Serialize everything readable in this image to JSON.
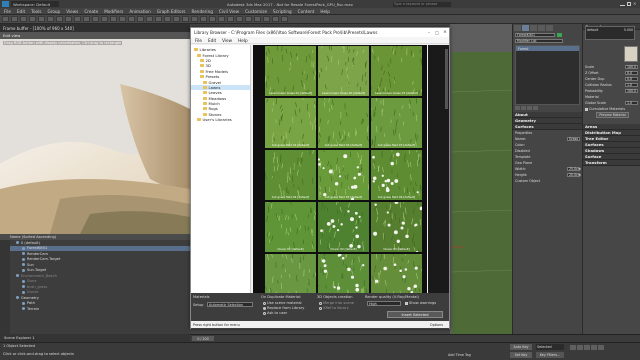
{
  "app": {
    "window_title": "Autodesk 3ds Max 2017 - Not for Resale   ForestPack_GPU_Rsc.max",
    "workspace": "Workspace: Default",
    "search_placeholder": "Type a keyword or phrase"
  },
  "menus": [
    "File",
    "Edit",
    "Tools",
    "Group",
    "Views",
    "Create",
    "Modifiers",
    "Animation",
    "Graph Editors",
    "Rendering",
    "Civil View",
    "Customize",
    "Scripting",
    "Content",
    "Help"
  ],
  "viewport": {
    "title": "Frame buffer - [100% of 960 x 540]",
    "subtitle": "Edit view",
    "hint": "Drag RGB button with display cancellation, Ctrl-drag to rectangle"
  },
  "scene_explorer": {
    "header": "Name (Sorted Ascending)",
    "rows": [
      {
        "label": "0 (default)",
        "sel": false,
        "dim": false,
        "indent": 2
      },
      {
        "label": "ForestKit01",
        "sel": true,
        "dim": false,
        "indent": 4
      },
      {
        "label": "RenderCam",
        "sel": false,
        "dim": false,
        "indent": 4
      },
      {
        "label": "RenderCam.Target",
        "sel": false,
        "dim": false,
        "indent": 4
      },
      {
        "label": "Sun",
        "sel": false,
        "dim": false,
        "indent": 4
      },
      {
        "label": "Sun.Target",
        "sel": false,
        "dim": false,
        "indent": 4
      },
      {
        "label": "Environment_Beach",
        "sel": false,
        "dim": true,
        "indent": 2
      },
      {
        "label": "Dune",
        "sel": false,
        "dim": true,
        "indent": 4
      },
      {
        "label": "bush_grass",
        "sel": false,
        "dim": true,
        "indent": 4
      },
      {
        "label": "Dunes",
        "sel": false,
        "dim": true,
        "indent": 4
      },
      {
        "label": "Geometry",
        "sel": false,
        "dim": false,
        "indent": 2
      },
      {
        "label": "Path",
        "sel": false,
        "dim": false,
        "indent": 4
      },
      {
        "label": "Terrain",
        "sel": false,
        "dim": false,
        "indent": 4
      }
    ],
    "footer": "Scene Explorer 1"
  },
  "library_browser": {
    "title": "Library Browser - C:\\Program Files (x86)\\Itoo Software\\Forest Pack Pro\\lib\\Presets\\Lawns",
    "menu": [
      "File",
      "Edit",
      "View",
      "Help"
    ],
    "tree": [
      {
        "label": "Libraries",
        "indent": 1,
        "sel": false
      },
      {
        "label": "Forest Library",
        "indent": 2,
        "sel": false
      },
      {
        "label": "2D",
        "indent": 3,
        "sel": false
      },
      {
        "label": "3D",
        "indent": 3,
        "sel": false
      },
      {
        "label": "Free Models",
        "indent": 3,
        "sel": false
      },
      {
        "label": "Presets",
        "indent": 3,
        "sel": false
      },
      {
        "label": "Gravel",
        "indent": 4,
        "sel": false
      },
      {
        "label": "Lawns",
        "indent": 4,
        "sel": true
      },
      {
        "label": "Leaves",
        "indent": 4,
        "sel": false
      },
      {
        "label": "Meadows",
        "indent": 4,
        "sel": false
      },
      {
        "label": "Mulch",
        "indent": 4,
        "sel": false
      },
      {
        "label": "Rugs",
        "indent": 4,
        "sel": false
      },
      {
        "label": "Stones",
        "indent": 4,
        "sel": false
      },
      {
        "label": "User's Libraries",
        "indent": 2,
        "sel": false
      }
    ],
    "thumbs": [
      {
        "caption": "Lawnmower Grass 01 [default]",
        "tone": "#6f9a3a",
        "flowers": false
      },
      {
        "caption": "Lawnmower Grass 02 [default]",
        "tone": "#7da448",
        "flowers": false
      },
      {
        "caption": "Lawnmower Grass 03 [default]",
        "tone": "#6a9536",
        "flowers": false
      },
      {
        "caption": "Cut grass field 01 [default]",
        "tone": "#78a443",
        "flowers": false
      },
      {
        "caption": "Cut grass field 02 [default]",
        "tone": "#6e9d3d",
        "flowers": false
      },
      {
        "caption": "Cut grass field 03 [default]",
        "tone": "#6b9a3f",
        "flowers": false
      },
      {
        "caption": "Cut grass field 04 [default]",
        "tone": "#5f8f34",
        "flowers": false
      },
      {
        "caption": "Cut grass field 05 [default]",
        "tone": "#6a9b3a",
        "flowers": true
      },
      {
        "caption": "Cut grass field 06 [default]",
        "tone": "#5d8c33",
        "flowers": true
      },
      {
        "caption": "Clover 01 [default]",
        "tone": "#5f9536",
        "flowers": false
      },
      {
        "caption": "Clover 02 [default]",
        "tone": "#4f8230",
        "flowers": true
      },
      {
        "caption": "Clover 03 [default]",
        "tone": "#557f2f",
        "flowers": true
      },
      {
        "caption": "",
        "tone": "#6a9842",
        "flowers": false
      },
      {
        "caption": "",
        "tone": "#5c8f38",
        "flowers": true
      },
      {
        "caption": "",
        "tone": "#648e3a",
        "flowers": true
      }
    ],
    "bottom": {
      "materials_label": "Materials",
      "dup_label": "On Duplicate Material:",
      "setup_label": "Setup",
      "setup_value": "Automatic Selection",
      "use_scene": "Use scene material",
      "replace_lib": "Replace from Library",
      "ask_user": "Ask to user",
      "objects_label": "3D Objects creation",
      "merge_scene": "Merge into scene",
      "xref_library": "XRef to library",
      "render_quality_label": "Render quality (V-Ray/Mental)",
      "quality_value": "High",
      "show_warnings": "Show warnings",
      "insert_button": "Insert Selected",
      "help_text": "Press right button for menu",
      "options_label": "Options"
    }
  },
  "command_panel": {
    "object_name": "ForestKit01",
    "modifier_list": "Modifier List",
    "modifier_item": "Forest",
    "rollouts_left": [
      "About",
      "Geometry",
      "Surfaces"
    ],
    "params": [
      {
        "label": "Properties",
        "value": ""
      },
      {
        "label": "Name:",
        "value": "Grass"
      },
      {
        "label": "Color:",
        "value": ""
      },
      {
        "label": "Disabled",
        "value": ""
      },
      {
        "label": "Template",
        "value": ""
      },
      {
        "label": "Geo Plane",
        "value": ""
      },
      {
        "label": "Width:",
        "value": "25.0cm"
      },
      {
        "label": "Height:",
        "value": "20.0cm"
      },
      {
        "label": "Custom Object",
        "value": ""
      }
    ],
    "geometry_header": "Geometry",
    "geometry_value": "default",
    "geometry_num": "5.000",
    "right_params": [
      {
        "label": "Scale",
        "value": "100.0"
      },
      {
        "label": "Z Offset",
        "value": "0.0"
      },
      {
        "label": "Center Dup",
        "value": "0.0"
      },
      {
        "label": "Collision Radius",
        "value": "1.0"
      },
      {
        "label": "Probability",
        "value": "100.0"
      },
      {
        "label": "Material",
        "value": ""
      },
      {
        "label": "Global Scale",
        "value": "1.0"
      }
    ],
    "cumulative": "Cumulative Materials",
    "preview_mat": "Preview Material",
    "rollouts_right": [
      "Areas",
      "Distribution Map",
      "Tree Editor",
      "Surfaces",
      "Shadows",
      "Surface",
      "Transform"
    ]
  },
  "status": {
    "selected": "1 Object Selected",
    "prompt": "Click or click-and-drag to select objects",
    "add_time_tag": "Add Time Tag",
    "auto_key": "Auto Key",
    "selected_label": "Selected",
    "set_key": "Set Key",
    "key_filters": "Key Filters...",
    "frame_counter": "0 / 100"
  },
  "colors": {
    "selection": "#5a6f8c",
    "accent": "#9fc0e0",
    "dialog_bg": "#f0f0f0"
  }
}
